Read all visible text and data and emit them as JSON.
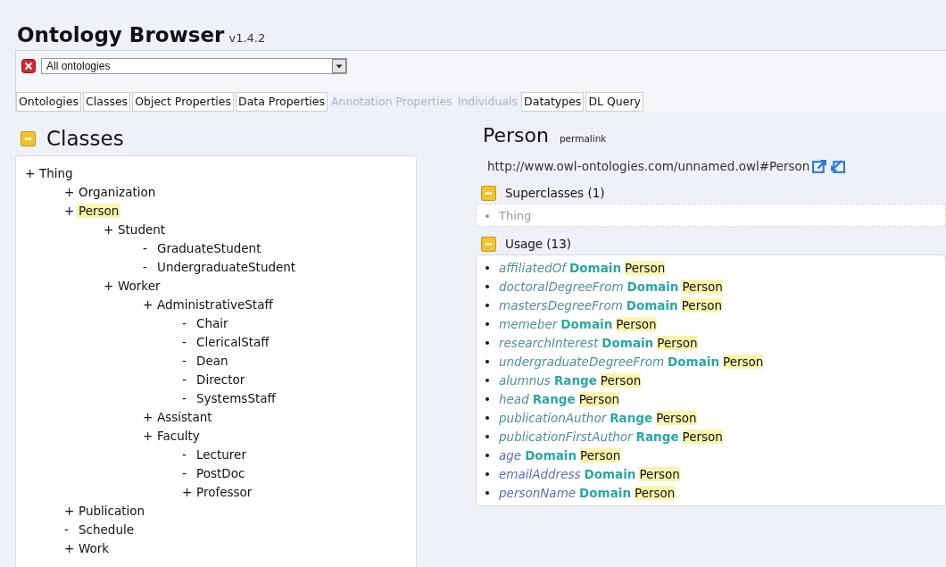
{
  "app": {
    "title": "Ontology Browser",
    "version": "v1.4.2"
  },
  "ontology_select": {
    "value": "All ontologies"
  },
  "tabs": [
    {
      "label": "Ontologies",
      "disabled": false
    },
    {
      "label": "Classes",
      "disabled": false
    },
    {
      "label": "Object Properties",
      "disabled": false
    },
    {
      "label": "Data Properties",
      "disabled": false
    },
    {
      "label": "Annotation Properties",
      "disabled": true
    },
    {
      "label": "Individuals",
      "disabled": true
    },
    {
      "label": "Datatypes",
      "disabled": false
    },
    {
      "label": "DL Query",
      "disabled": false
    }
  ],
  "classes": {
    "title": "Classes",
    "expanded": true,
    "tree": [
      {
        "marker": "+",
        "label": "Thing",
        "selected": false,
        "children": [
          {
            "marker": "+",
            "label": "Organization",
            "selected": false
          },
          {
            "marker": "+",
            "label": "Person",
            "selected": true,
            "children": [
              {
                "marker": "+",
                "label": "Student",
                "selected": false,
                "children": [
                  {
                    "marker": "-",
                    "label": "GraduateStudent",
                    "selected": false
                  },
                  {
                    "marker": "-",
                    "label": "UndergraduateStudent",
                    "selected": false
                  }
                ]
              },
              {
                "marker": "+",
                "label": "Worker",
                "selected": false,
                "children": [
                  {
                    "marker": "+",
                    "label": "AdministrativeStaff",
                    "selected": false,
                    "children": [
                      {
                        "marker": "-",
                        "label": "Chair",
                        "selected": false
                      },
                      {
                        "marker": "-",
                        "label": "ClericalStaff",
                        "selected": false
                      },
                      {
                        "marker": "-",
                        "label": "Dean",
                        "selected": false
                      },
                      {
                        "marker": "-",
                        "label": "Director",
                        "selected": false
                      },
                      {
                        "marker": "-",
                        "label": "SystemsStaff",
                        "selected": false
                      }
                    ]
                  },
                  {
                    "marker": "+",
                    "label": "Assistant",
                    "selected": false
                  },
                  {
                    "marker": "+",
                    "label": "Faculty",
                    "selected": false,
                    "children": [
                      {
                        "marker": "-",
                        "label": "Lecturer",
                        "selected": false
                      },
                      {
                        "marker": "-",
                        "label": "PostDoc",
                        "selected": false
                      },
                      {
                        "marker": "+",
                        "label": "Professor",
                        "selected": false
                      }
                    ]
                  }
                ]
              }
            ]
          },
          {
            "marker": "+",
            "label": "Publication",
            "selected": false
          },
          {
            "marker": "-",
            "label": "Schedule",
            "selected": false
          },
          {
            "marker": "+",
            "label": "Work",
            "selected": false
          }
        ]
      }
    ]
  },
  "detail": {
    "title": "Person",
    "permalink": "permalink",
    "iri": "http://www.owl-ontologies.com/unnamed.owl#Person",
    "superclasses": {
      "title": "Superclasses (1)",
      "expanded": true,
      "items": [
        "Thing"
      ]
    },
    "usage": {
      "title": "Usage (13)",
      "expanded": true,
      "items": [
        {
          "property": "affiliatedOf",
          "kind": "object",
          "relation": "Domain",
          "class": "Person"
        },
        {
          "property": "doctoralDegreeFrom",
          "kind": "object",
          "relation": "Domain",
          "class": "Person"
        },
        {
          "property": "mastersDegreeFrom",
          "kind": "object",
          "relation": "Domain",
          "class": "Person"
        },
        {
          "property": "memeber",
          "kind": "object",
          "relation": "Domain",
          "class": "Person"
        },
        {
          "property": "researchInterest",
          "kind": "object",
          "relation": "Domain",
          "class": "Person"
        },
        {
          "property": "undergraduateDegreeFrom",
          "kind": "object",
          "relation": "Domain",
          "class": "Person"
        },
        {
          "property": "alumnus",
          "kind": "object",
          "relation": "Range",
          "class": "Person"
        },
        {
          "property": "head",
          "kind": "object",
          "relation": "Range",
          "class": "Person"
        },
        {
          "property": "publicationAuthor",
          "kind": "object",
          "relation": "Range",
          "class": "Person"
        },
        {
          "property": "publicationFirstAuthor",
          "kind": "object",
          "relation": "Range",
          "class": "Person"
        },
        {
          "property": "age",
          "kind": "data",
          "relation": "Domain",
          "class": "Person"
        },
        {
          "property": "emailAddress",
          "kind": "data",
          "relation": "Domain",
          "class": "Person"
        },
        {
          "property": "personName",
          "kind": "data",
          "relation": "Domain",
          "class": "Person"
        }
      ]
    }
  }
}
